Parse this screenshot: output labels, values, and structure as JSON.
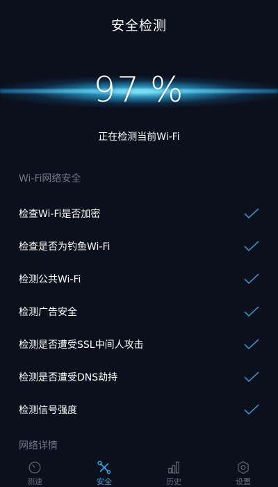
{
  "header": {
    "title": "安全检测"
  },
  "progress": {
    "value": 97,
    "unit": "%"
  },
  "status": {
    "text": "正在检测当前Wi-Fi"
  },
  "wifi_section": {
    "title": "Wi-Fi网络安全",
    "items": [
      {
        "label": "检查Wi-Fi是否加密",
        "checked": true
      },
      {
        "label": "检查是否为钓鱼Wi-Fi",
        "checked": true
      },
      {
        "label": "检测公共Wi-Fi",
        "checked": true
      },
      {
        "label": "检测广告安全",
        "checked": true
      },
      {
        "label": "检测是否遭受SSL中间人攻击",
        "checked": true
      },
      {
        "label": "检测是否遭受DNS劫持",
        "checked": true
      },
      {
        "label": "检测信号强度",
        "checked": true
      }
    ]
  },
  "next_section": {
    "title": "网络详情"
  },
  "tabbar": {
    "accent": "#3ba8e8",
    "tabs": [
      {
        "label": "测速",
        "icon": "speedometer-icon"
      },
      {
        "label": "安全",
        "icon": "tools-icon",
        "active": true
      },
      {
        "label": "历史",
        "icon": "bar-chart-icon"
      },
      {
        "label": "设置",
        "icon": "gear-icon"
      }
    ]
  }
}
